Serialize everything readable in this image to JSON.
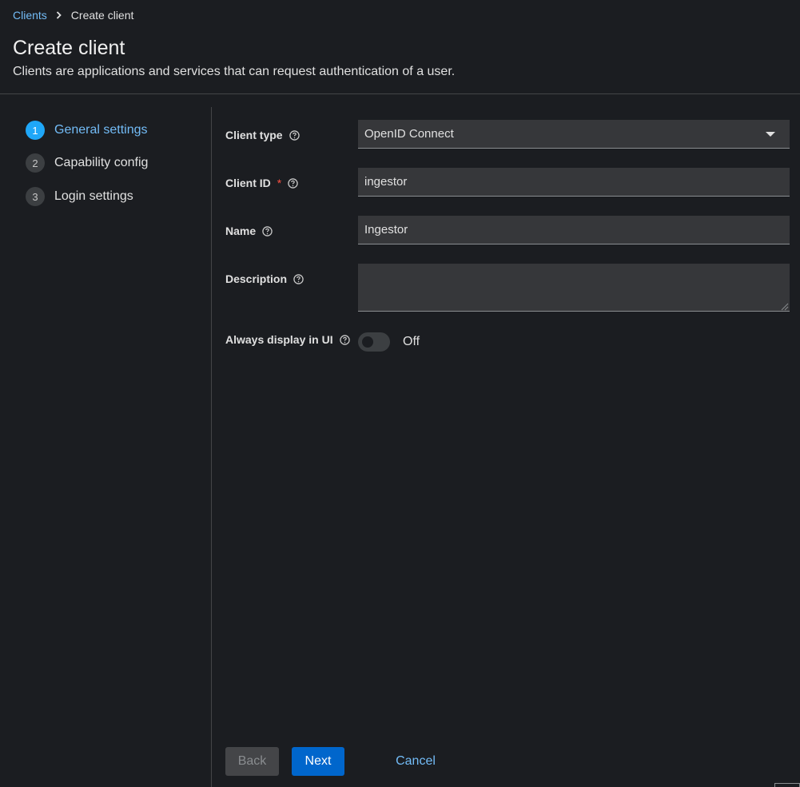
{
  "breadcrumb": {
    "parent": "Clients",
    "current": "Create client"
  },
  "header": {
    "title": "Create client",
    "subtitle": "Clients are applications and services that can request authentication of a user."
  },
  "wizard": {
    "steps": [
      {
        "number": "1",
        "label": "General settings",
        "current": true
      },
      {
        "number": "2",
        "label": "Capability config",
        "current": false
      },
      {
        "number": "3",
        "label": "Login settings",
        "current": false
      }
    ]
  },
  "form": {
    "client_type": {
      "label": "Client type",
      "value": "OpenID Connect"
    },
    "client_id": {
      "label": "Client ID",
      "required_mark": "*",
      "value": "ingestor"
    },
    "name": {
      "label": "Name",
      "value": "Ingestor"
    },
    "description": {
      "label": "Description",
      "value": ""
    },
    "always_display": {
      "label": "Always display in UI",
      "state_label": "Off",
      "on": false
    }
  },
  "footer": {
    "back_label": "Back",
    "next_label": "Next",
    "cancel_label": "Cancel"
  },
  "colors": {
    "background": "#1b1d21",
    "accent": "#73bcf7",
    "primary_button": "#0066cc",
    "current_step": "#1fa7f8",
    "required": "#fe5142"
  },
  "icons": {
    "breadcrumb_separator": "chevron-right-icon",
    "help": "help-circle-icon",
    "select_caret": "caret-down-icon"
  }
}
